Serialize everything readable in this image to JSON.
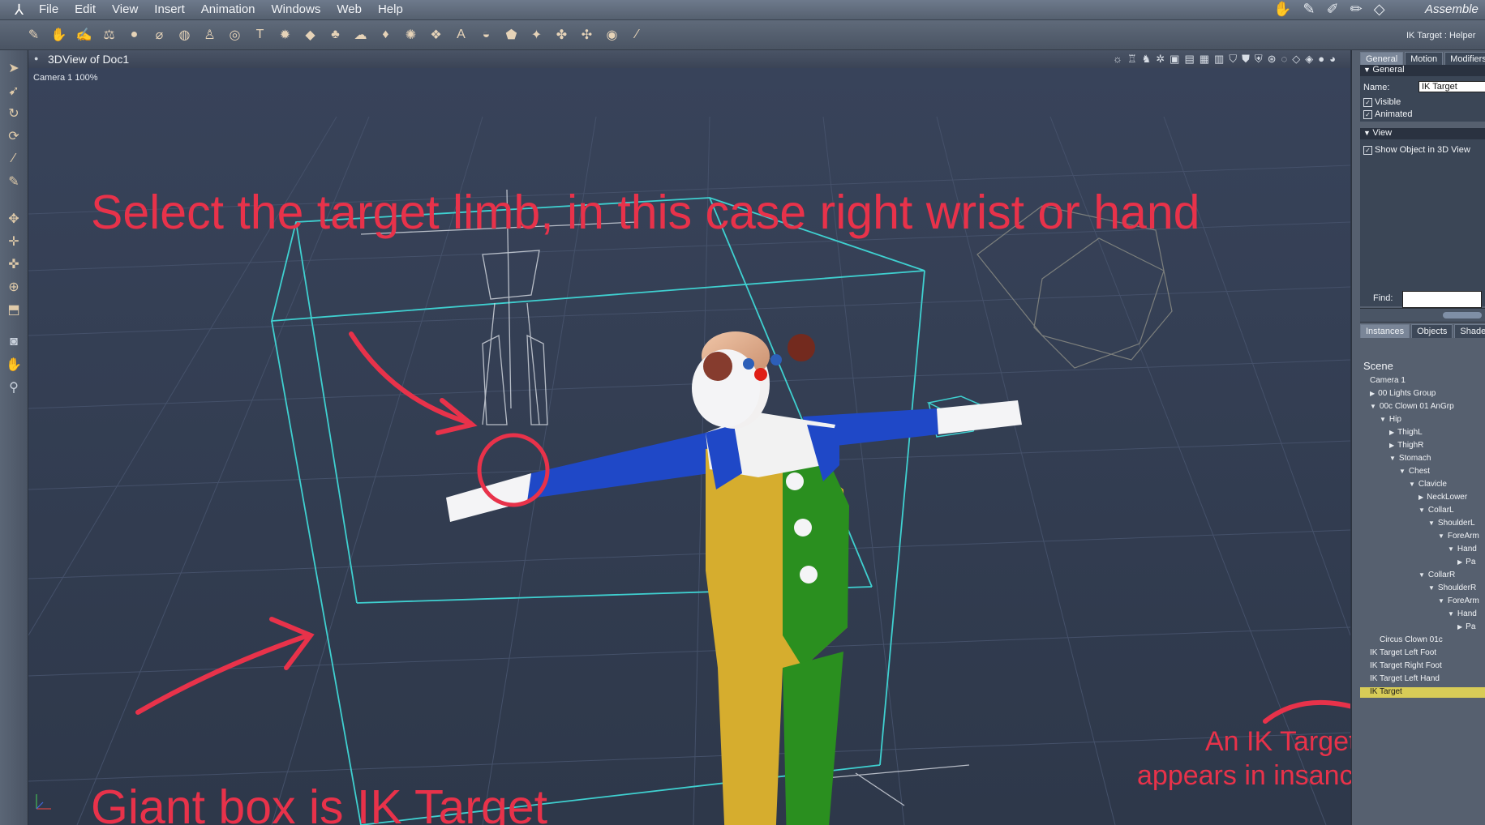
{
  "app": {
    "menu": [
      "File",
      "Edit",
      "View",
      "Insert",
      "Animation",
      "Windows",
      "Web",
      "Help"
    ],
    "room_name": "Assemble"
  },
  "toolbar": {
    "icons": [
      "brush-icon",
      "hand-icon",
      "paint-icon",
      "scale-icon",
      "sphere-icon",
      "cylinder-icon",
      "globe-icon",
      "figure-icon",
      "target-icon",
      "text-icon",
      "gear-icon",
      "plane-icon",
      "tree-icon",
      "cloud-icon",
      "drop-icon",
      "mesh-icon",
      "surface-icon",
      "agi-icon",
      "bowl-icon",
      "rock-icon",
      "pin-icon",
      "plant-icon",
      "bones-icon",
      "ring-icon",
      "wand-icon"
    ],
    "helper_title": "IK Target : Helper"
  },
  "viewport": {
    "title": "3DView of Doc1",
    "camera_label": "Camera 1 100%"
  },
  "annotations": {
    "top": "Select the target limb, in this case right wrist or hand",
    "bottom": "Giant box is IK Target",
    "right_line1": "An IK Target",
    "right_line2": "appears in insances tab"
  },
  "properties": {
    "tabs": [
      "General",
      "Motion",
      "Modifiers"
    ],
    "active_tab": "General",
    "general_header": "General",
    "name_label": "Name:",
    "name_value": "IK Target",
    "visible_label": "Visible",
    "visible_checked": true,
    "animated_label": "Animated",
    "animated_checked": true,
    "view_header": "View",
    "show_object_label": "Show Object in 3D View",
    "show_object_checked": true
  },
  "instances": {
    "tabs": [
      "Instances",
      "Objects",
      "Shaders"
    ],
    "active_tab": "Instances",
    "find_label": "Find:",
    "find_value": "",
    "scene_label": "Scene",
    "tree": [
      {
        "label": "Camera 1",
        "indent": 0,
        "expand": "none"
      },
      {
        "label": "00 Lights Group",
        "indent": 0,
        "expand": "collapsed"
      },
      {
        "label": "00c Clown 01 AnGrp",
        "indent": 0,
        "expand": "expanded"
      },
      {
        "label": "Hip",
        "indent": 1,
        "expand": "expanded"
      },
      {
        "label": "ThighL",
        "indent": 2,
        "expand": "collapsed"
      },
      {
        "label": "ThighR",
        "indent": 2,
        "expand": "collapsed"
      },
      {
        "label": "Stomach",
        "indent": 2,
        "expand": "expanded"
      },
      {
        "label": "Chest",
        "indent": 3,
        "expand": "expanded"
      },
      {
        "label": "Clavicle",
        "indent": 4,
        "expand": "expanded"
      },
      {
        "label": "NeckLower",
        "indent": 5,
        "expand": "collapsed"
      },
      {
        "label": "CollarL",
        "indent": 5,
        "expand": "expanded"
      },
      {
        "label": "ShoulderL",
        "indent": 6,
        "expand": "expanded"
      },
      {
        "label": "ForeArm",
        "indent": 7,
        "expand": "expanded"
      },
      {
        "label": "Hand",
        "indent": 8,
        "expand": "expanded"
      },
      {
        "label": "Pa",
        "indent": 9,
        "expand": "collapsed"
      },
      {
        "label": "CollarR",
        "indent": 5,
        "expand": "expanded"
      },
      {
        "label": "ShoulderR",
        "indent": 6,
        "expand": "expanded"
      },
      {
        "label": "ForeArm",
        "indent": 7,
        "expand": "expanded"
      },
      {
        "label": "Hand",
        "indent": 8,
        "expand": "expanded"
      },
      {
        "label": "Pa",
        "indent": 9,
        "expand": "collapsed"
      },
      {
        "label": "Circus Clown 01c",
        "indent": 1,
        "expand": "none"
      },
      {
        "label": "IK Target Left Foot",
        "indent": 0,
        "expand": "none"
      },
      {
        "label": "IK Target Right Foot",
        "indent": 0,
        "expand": "none"
      },
      {
        "label": "IK Target Left Hand",
        "indent": 0,
        "expand": "none"
      },
      {
        "label": "IK Target",
        "indent": 0,
        "expand": "none",
        "selected": true
      }
    ]
  },
  "colors": {
    "annotation": "#e8324a",
    "selection": "#d8cc57",
    "box_outline": "#3fd0d0",
    "viewport_bg": "#313b4d"
  }
}
